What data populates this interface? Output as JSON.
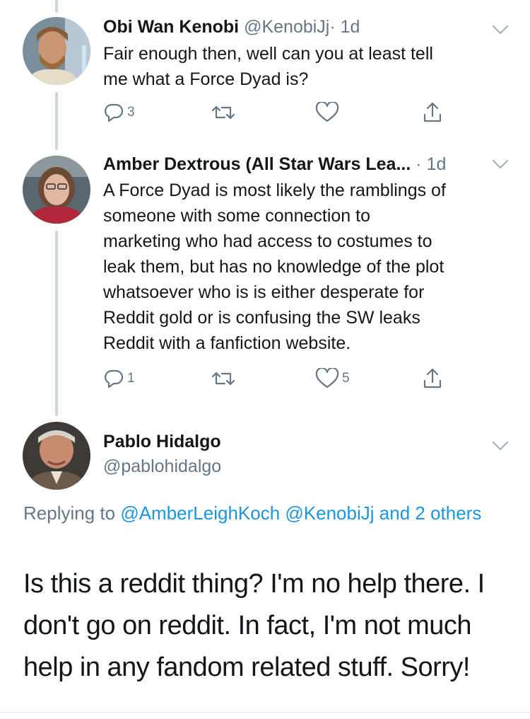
{
  "tweets": [
    {
      "name": "Obi Wan Kenobi",
      "handle": "@KenobiJj",
      "dot": "·",
      "time": "1d",
      "text_lines": [
        "Fair enough then, well can you at least tell",
        "me what a Force Dyad is?"
      ],
      "reply_count": "3",
      "retweet_count": "",
      "like_count": ""
    },
    {
      "name": "Amber Dextrous (All Star Wars Lea...",
      "dot": "·",
      "time": "1d",
      "text_lines": [
        "A Force Dyad is most likely the ramblings of",
        "someone with some connection to",
        "marketing who had access to costumes to",
        "leak them, but has no knowledge of the plot",
        "whatsoever who is is either desperate for",
        "Reddit gold or is confusing the SW leaks",
        "Reddit with a fanfiction website."
      ],
      "reply_count": "1",
      "retweet_count": "",
      "like_count": "5"
    }
  ],
  "main_tweet": {
    "name": "Pablo Hidalgo",
    "handle": "@pablohidalgo",
    "replying_prefix": "Replying to",
    "mention_1": "@AmberLeighKoch",
    "mention_2": "@KenobiJj",
    "and_others": "and 2 others",
    "text_lines": [
      "Is this a reddit thing? I'm no help there. I",
      "don't go on reddit. In fact, I'm not much",
      "help in any fandom related stuff. Sorry!"
    ]
  },
  "colors": {
    "link": "#1b95e0",
    "secondary_text": "#657786",
    "thread_line": "#ccd6dd",
    "icon": "#657786"
  },
  "icons": [
    "reply-icon",
    "retweet-icon",
    "like-icon",
    "share-icon",
    "chevron-down-icon"
  ]
}
